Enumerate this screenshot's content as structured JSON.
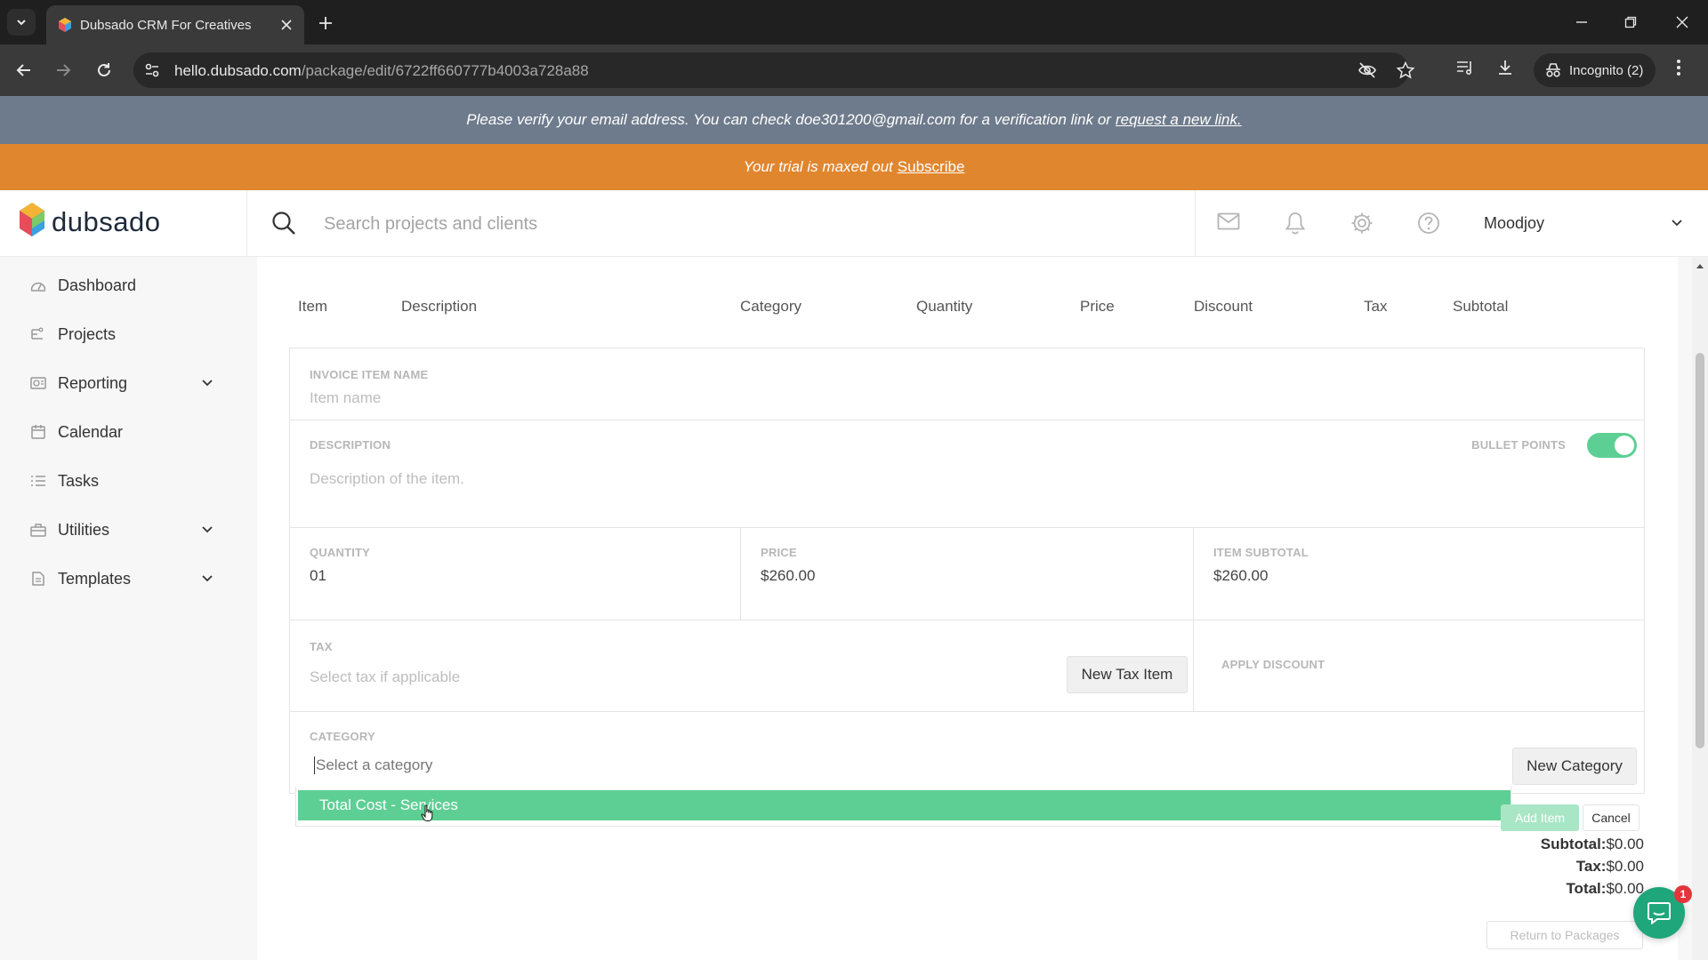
{
  "browser": {
    "tab_title": "Dubsado CRM For Creatives",
    "url_host": "hello.dubsado.com",
    "url_path": "/package/edit/6722ff660777b4003a728a88",
    "incognito_label": "Incognito (2)"
  },
  "banners": {
    "verify_text": "Please verify your email address. You can check doe301200@gmail.com for a verification link or",
    "verify_link": "request a new link.",
    "trial_text": "Your trial is maxed out",
    "trial_link": "Subscribe"
  },
  "header": {
    "logo_text": "dubsado",
    "search_placeholder": "Search projects and clients",
    "user_name": "Moodjoy"
  },
  "sidebar": {
    "items": [
      {
        "label": "Dashboard",
        "icon": "dashboard-icon"
      },
      {
        "label": "Projects",
        "icon": "projects-icon"
      },
      {
        "label": "Reporting",
        "icon": "reporting-icon"
      },
      {
        "label": "Calendar",
        "icon": "calendar-icon"
      },
      {
        "label": "Tasks",
        "icon": "tasks-icon"
      },
      {
        "label": "Utilities",
        "icon": "utilities-icon"
      },
      {
        "label": "Templates",
        "icon": "templates-icon"
      }
    ]
  },
  "table": {
    "columns": [
      "Item",
      "Description",
      "Category",
      "Quantity",
      "Price",
      "Discount",
      "Tax",
      "Subtotal"
    ]
  },
  "form": {
    "item_name_label": "INVOICE ITEM NAME",
    "item_name_placeholder": "Item name",
    "description_label": "DESCRIPTION",
    "description_placeholder": "Description of the item.",
    "bullet_points_label": "BULLET POINTS",
    "bullet_points_on": true,
    "quantity_label": "QUANTITY",
    "quantity_value": "01",
    "price_label": "PRICE",
    "price_value": "$260.00",
    "item_subtotal_label": "ITEM SUBTOTAL",
    "item_subtotal_value": "$260.00",
    "tax_label": "TAX",
    "tax_placeholder": "Select tax if applicable",
    "new_tax_button": "New Tax Item",
    "apply_discount_label": "APPLY DISCOUNT",
    "category_label": "CATEGORY",
    "category_placeholder": "Select a category",
    "new_category_button": "New Category",
    "dropdown_option": "Total Cost - Services",
    "add_item_button": "Add Item",
    "cancel_button": "Cancel"
  },
  "totals": {
    "subtotal_label": "Subtotal:",
    "subtotal_value": "$0.00",
    "tax_label": "Tax:",
    "tax_value": "$0.00",
    "total_label": "Total:",
    "total_value": "$0.00"
  },
  "return_button": "Return to Packages",
  "chat_badge": "1",
  "colors": {
    "accent_green": "#5ecf94",
    "trial_orange": "#e0862f",
    "verify_slate": "#6e7b8c"
  }
}
